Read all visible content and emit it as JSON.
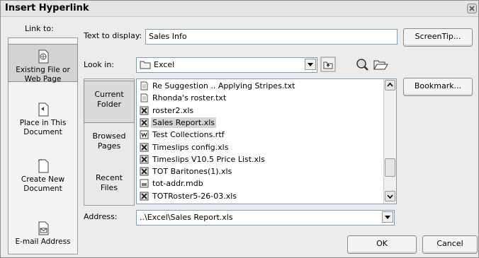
{
  "title": "Insert Hyperlink",
  "link_to": {
    "label": "Link to:",
    "items": [
      {
        "line1": "Existing File or",
        "line2": "Web Page",
        "selected": true
      },
      {
        "line1": "Place in This",
        "line2": "Document",
        "selected": false
      },
      {
        "line1": "Create New",
        "line2": "Document",
        "selected": false
      },
      {
        "line1": "E-mail Address",
        "line2": "",
        "selected": false
      }
    ]
  },
  "text_display": {
    "label": "Text to display:",
    "value": "Sales Info"
  },
  "screentip_label": "ScreenTip...",
  "look_in": {
    "label": "Look in:",
    "value": "Excel"
  },
  "bookmark_label": "Bookmark...",
  "look_panel": [
    {
      "line1": "Current",
      "line2": "Folder",
      "selected": true
    },
    {
      "line1": "Browsed",
      "line2": "Pages",
      "selected": false
    },
    {
      "line1": "Recent",
      "line2": "Files",
      "selected": false
    }
  ],
  "files": [
    {
      "name": "Re Suggestion .. Applying Stripes.txt",
      "icon": "text-file-icon",
      "selected": false
    },
    {
      "name": "Rhonda's roster.txt",
      "icon": "text-file-icon",
      "selected": false
    },
    {
      "name": "roster2.xls",
      "icon": "excel-file-icon",
      "selected": false
    },
    {
      "name": "Sales Report.xls",
      "icon": "excel-file-icon",
      "selected": true
    },
    {
      "name": "Test Collections.rtf",
      "icon": "word-file-icon",
      "selected": false
    },
    {
      "name": "Timeslips config.xls",
      "icon": "excel-file-icon",
      "selected": false
    },
    {
      "name": "Timeslips V10.5 Price List.xls",
      "icon": "excel-file-icon",
      "selected": false
    },
    {
      "name": "TOT Baritones(1).xls",
      "icon": "excel-file-icon",
      "selected": false
    },
    {
      "name": "tot-addr.mdb",
      "icon": "access-file-icon",
      "selected": false
    },
    {
      "name": "TOTRoster5-26-03.xls",
      "icon": "excel-file-icon",
      "selected": false
    }
  ],
  "address": {
    "label": "Address:",
    "value": "..\\Excel\\Sales Report.xls"
  },
  "ok_label": "OK",
  "cancel_label": "Cancel"
}
